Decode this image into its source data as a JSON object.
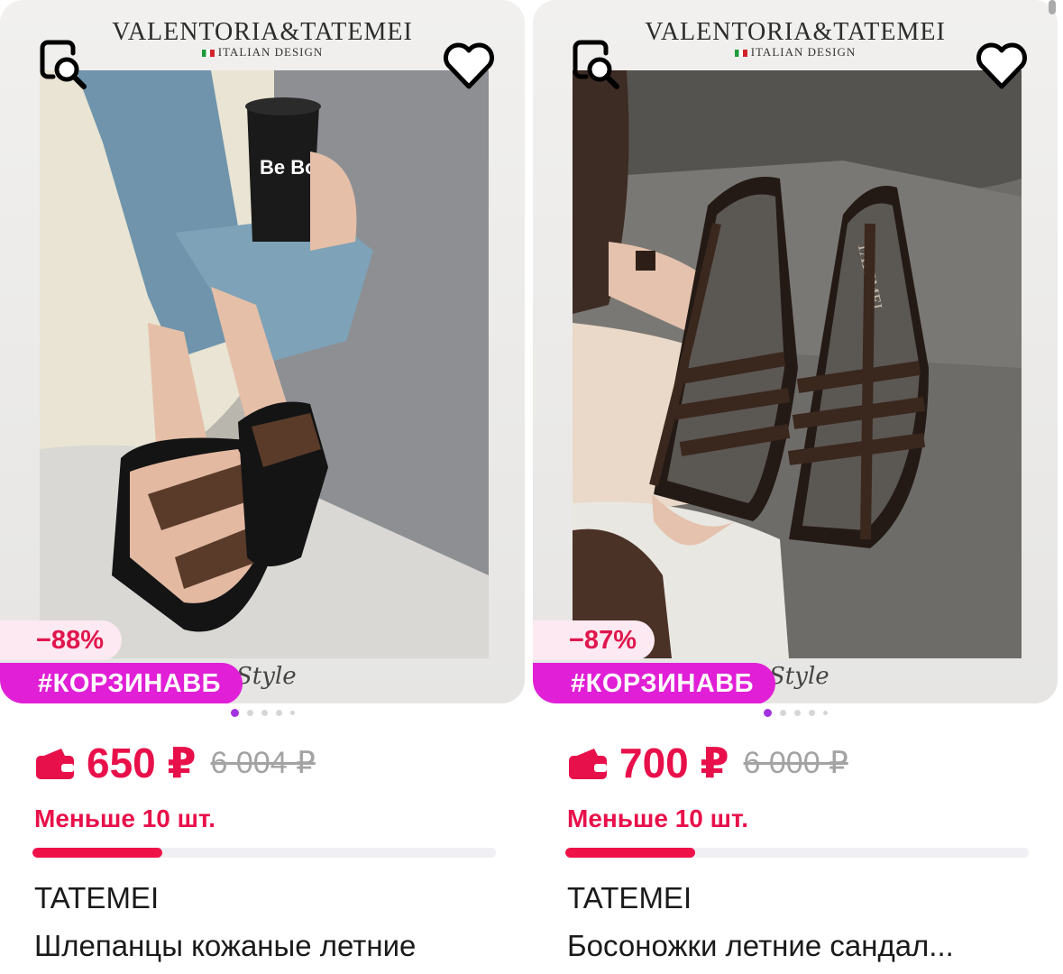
{
  "products": [
    {
      "frame_title": "VALENTORIA&TATEMEI",
      "frame_subtitle": "ITALIAN DESIGN",
      "frame_footer": "Style",
      "cup_text": "Be Bou",
      "discount": "−88%",
      "promo_tag": "#КОРЗИНАВБ",
      "price": "650 ₽",
      "old_price": "6 004 ₽",
      "stock_text": "Меньше 10 шт.",
      "stock_level": 0.28,
      "brand": "TATEMEI",
      "name": "Шлепанцы кожаные летние"
    },
    {
      "frame_title": "VALENTORIA&TATEMEI",
      "frame_subtitle": "ITALIAN DESIGN",
      "frame_footer": "Style",
      "insole_text": "TATEMEI",
      "discount": "−87%",
      "promo_tag": "#КОРЗИНАВБ",
      "price": "700 ₽",
      "old_price": "6 000 ₽",
      "stock_text": "Меньше 10 шт.",
      "stock_level": 0.28,
      "brand": "TATEMEI",
      "name": "Босоножки летние сандал..."
    }
  ],
  "icons": {
    "zoom": "image-search-icon",
    "favorite": "heart-icon",
    "wallet": "wallet-icon"
  },
  "colors": {
    "price": "#e8104a",
    "promo": "#e01fd6",
    "discount_bg": "#fde9f1",
    "active_dot": "#a233e0"
  }
}
